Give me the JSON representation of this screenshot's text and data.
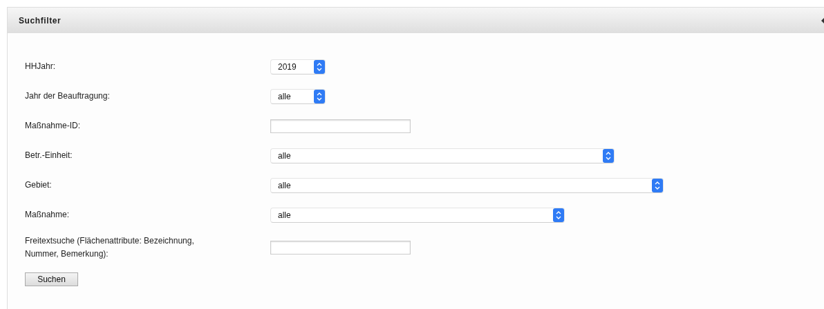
{
  "panel": {
    "title": "Suchfilter"
  },
  "fields": [
    {
      "label": "HHJahr:",
      "kind": "select",
      "value": "2019"
    },
    {
      "label": "Jahr der Beauftragung:",
      "kind": "select",
      "value": "alle"
    },
    {
      "label": "Maßnahme-ID:",
      "kind": "text"
    },
    {
      "label": "Betr.-Einheit:",
      "kind": "select",
      "value": "alle"
    },
    {
      "label": "Gebiet:",
      "kind": "select",
      "value": "alle"
    },
    {
      "label": "Maßnahme:",
      "kind": "select",
      "value": "alle"
    },
    {
      "label": "Freitextsuche (Flächenattribute: Bezeichnung, Nummer, Bemerkung):",
      "kind": "text"
    }
  ],
  "button": "Suchen"
}
